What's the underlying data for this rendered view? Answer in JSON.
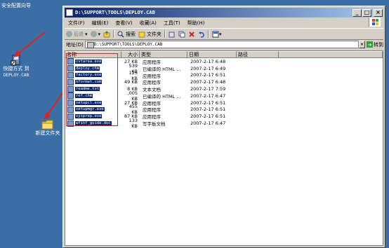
{
  "desktop": {
    "icon1_label": "安全配置向导",
    "icon2_label_line1": "快捷方式 到",
    "icon2_label_line2": "DEPLOY.CAB",
    "icon3_label": "新建文件夹"
  },
  "window": {
    "title": "D:\\SUPPORT\\TOOLS\\DEPLOY.CAB",
    "min": "_",
    "max": "□",
    "close": "×"
  },
  "menu": [
    "文件(F)",
    "编辑(E)",
    "查看(V)",
    "收藏(A)",
    "工具(T)",
    "帮助(H)"
  ],
  "toolbar": {
    "back": "后退",
    "search": "搜索",
    "folders": "文件夹"
  },
  "address": {
    "label": "地址(D)",
    "value": "D:\\SUPPORT\\TOOLS\\DEPLOY.CAB",
    "go": "转到"
  },
  "columns": {
    "name": "名称",
    "size": "大小",
    "type": "类型",
    "date": "日期",
    "path": "路径"
  },
  "files": [
    {
      "name": "cvtarea.exe",
      "size": "27 KB",
      "type": "应用程序",
      "date": "2007-2-17 6:48"
    },
    {
      "name": "deploy.chm",
      "size": "539 KB",
      "type": "已编译的 HTML ...",
      "date": "2007-2-17 6:49"
    },
    {
      "name": "factory.exe",
      "size": "125 KB",
      "type": "应用程序",
      "date": "2007-2-17 6:51"
    },
    {
      "name": "oformat.com",
      "size": "49 KB",
      "type": "应用程序",
      "date": "2007-2-17 6:48"
    },
    {
      "name": "readme.txt",
      "size": "8 KB",
      "type": "文本文档",
      "date": "2007-2-17 7:59"
    },
    {
      "name": "ref.chm",
      "size": ",005 KB",
      "type": "已编译的 HTML ...",
      "date": "2007-2-17 6:47"
    },
    {
      "name": "setupcl.exe",
      "size": "27 KB",
      "type": "应用程序",
      "date": "2007-2-17 6:51"
    },
    {
      "name": "setupmgr.exe",
      "size": "455 KB",
      "type": "应用程序",
      "date": "2007-2-17 6:51"
    },
    {
      "name": "sysprep.exe",
      "size": "87 KB",
      "type": "应用程序",
      "date": "2007-2-17 6:51"
    },
    {
      "name": "wfinf_guide.doc",
      "size": "133 KB",
      "type": "写字板文档",
      "date": "2007-2-17 6:47"
    }
  ],
  "colors": {
    "desktop": "#3a6ea5",
    "titlebar": "#0a246a",
    "selection": "#0a246a",
    "highlight_box": "#e02020"
  }
}
